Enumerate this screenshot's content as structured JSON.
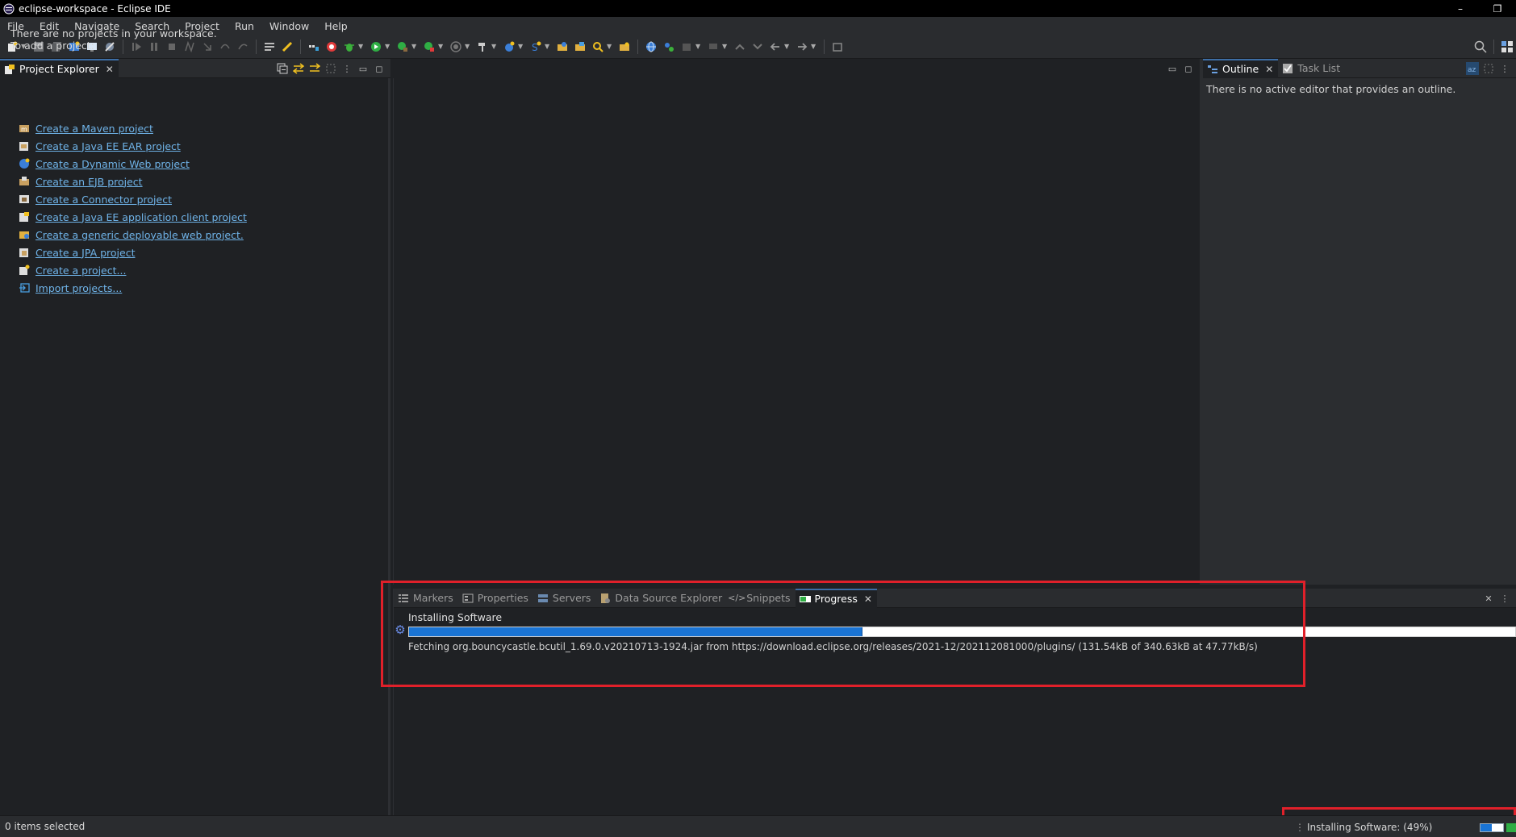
{
  "window": {
    "title": "eclipse-workspace - Eclipse IDE",
    "minimize": "–",
    "restore": "❐"
  },
  "menu": [
    "File",
    "Edit",
    "Navigate",
    "Search",
    "Project",
    "Run",
    "Window",
    "Help"
  ],
  "project_explorer": {
    "tab_label": "Project Explorer",
    "message_line1": "There are no projects in your workspace.",
    "message_line2": "To add a project:",
    "links": [
      {
        "label": "Create a Maven project",
        "icon": "maven-project-icon"
      },
      {
        "label": "Create a Java EE EAR project",
        "icon": "ear-project-icon"
      },
      {
        "label": "Create a Dynamic Web project",
        "icon": "web-project-icon"
      },
      {
        "label": "Create an EJB project",
        "icon": "ejb-project-icon"
      },
      {
        "label": "Create a Connector project",
        "icon": "connector-project-icon"
      },
      {
        "label": "Create a Java EE application client project",
        "icon": "app-client-project-icon"
      },
      {
        "label": "Create a generic deployable web project.",
        "icon": "deployable-web-project-icon"
      },
      {
        "label": "Create a JPA project",
        "icon": "jpa-project-icon"
      },
      {
        "label": "Create a project...",
        "icon": "new-project-icon"
      },
      {
        "label": "Import projects...",
        "icon": "import-icon"
      }
    ]
  },
  "outline": {
    "tab_outline": "Outline",
    "tab_tasklist": "Task List",
    "message": "There is no active editor that provides an outline."
  },
  "bottom_tabs": [
    {
      "label": "Markers",
      "icon": "markers-icon",
      "active": false
    },
    {
      "label": "Properties",
      "icon": "properties-icon",
      "active": false
    },
    {
      "label": "Servers",
      "icon": "servers-icon",
      "active": false
    },
    {
      "label": "Data Source Explorer",
      "icon": "data-source-icon",
      "active": false
    },
    {
      "label": "Snippets",
      "icon": "snippets-icon",
      "active": false
    },
    {
      "label": "Progress",
      "icon": "progress-icon",
      "active": true
    }
  ],
  "progress": {
    "title": "Installing Software",
    "fraction": 0.41,
    "detail": "Fetching org.bouncycastle.bcutil_1.69.0.v20210713-1924.jar from https://download.eclipse.org/releases/2021-12/202112081000/plugins/ (131.54kB of 340.63kB at 47.77kB/s)"
  },
  "status": {
    "selection": "0 items selected",
    "job": "Installing Software: (49%)",
    "job_fraction": 0.49
  },
  "colors": {
    "accent": "#1a74d4",
    "link": "#6fb3e8",
    "highlight": "#e0202a"
  }
}
